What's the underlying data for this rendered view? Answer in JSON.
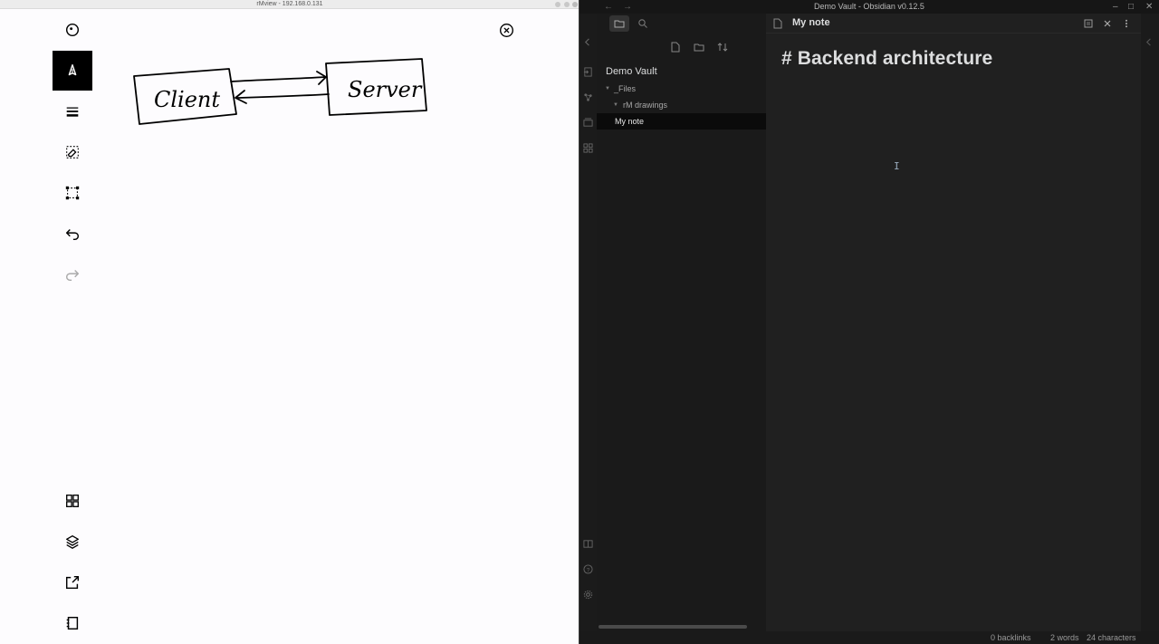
{
  "rmview": {
    "window_title": "rMview - 192.168.0.131",
    "tools": [
      {
        "name": "tool-toggle-icon"
      },
      {
        "name": "pen-tool-icon"
      },
      {
        "name": "stroke-size-icon"
      },
      {
        "name": "selection-eraser-icon"
      },
      {
        "name": "select-lasso-icon"
      },
      {
        "name": "undo-icon"
      },
      {
        "name": "redo-icon"
      }
    ],
    "bottom_tools": [
      {
        "name": "grid-view-icon"
      },
      {
        "name": "layers-icon"
      },
      {
        "name": "share-icon"
      },
      {
        "name": "notebook-icon"
      }
    ],
    "drawing": {
      "box_left_label": "Client",
      "box_right_label": "Server"
    }
  },
  "obsidian": {
    "window_title": "Demo Vault - Obsidian v0.12.5",
    "tab_title": "My note",
    "vault_name": "Demo Vault",
    "tree": [
      {
        "label": "_Files",
        "expanded": true
      },
      {
        "label": "rM drawings",
        "expanded": true
      },
      {
        "label": "My note",
        "selected": true
      }
    ],
    "document": {
      "heading": "# Backend architecture"
    },
    "status": {
      "backlinks": "0 backlinks",
      "words": "2 words",
      "characters": "24 characters"
    },
    "colors": {
      "background": "#202020",
      "sidebar": "#1a1a1a",
      "text": "#dcddde",
      "selected_row": "#0b0b0b"
    }
  }
}
